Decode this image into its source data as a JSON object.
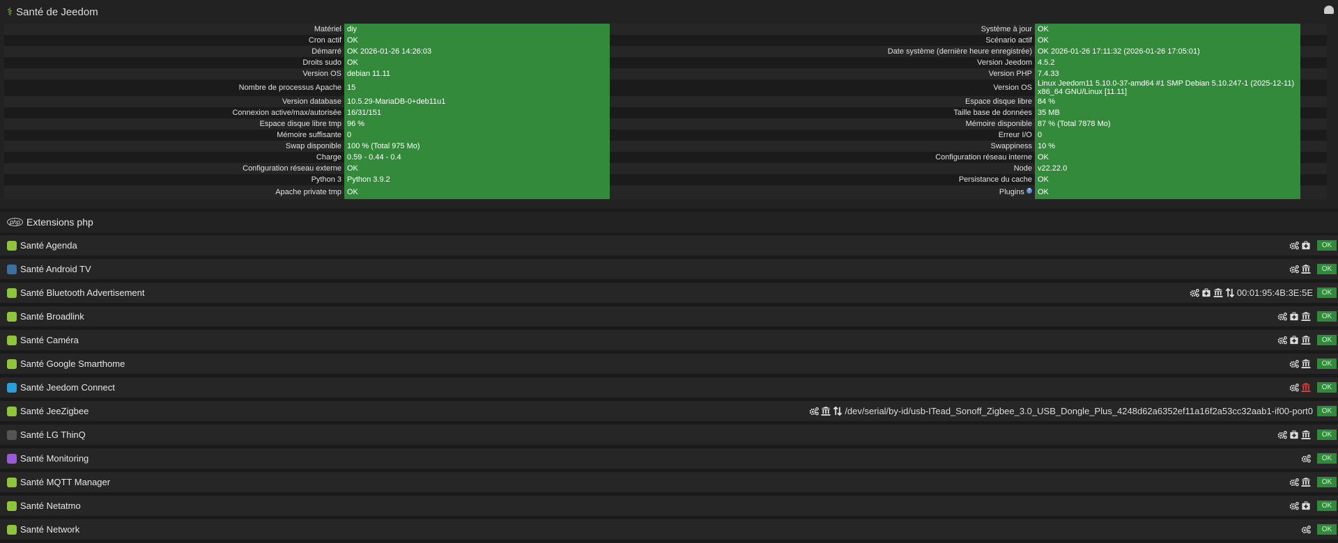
{
  "header": {
    "title": "Santé de Jeedom"
  },
  "left_table": [
    [
      "Matériel",
      "diy"
    ],
    [
      "Cron actif",
      "OK"
    ],
    [
      "Démarré",
      "OK 2026-01-26 14:26:03"
    ],
    [
      "Droits sudo",
      "OK"
    ],
    [
      "Version OS",
      "debian 11.11"
    ],
    [
      "Nombre de processus Apache",
      "15"
    ],
    [
      "Version database",
      "10.5.29-MariaDB-0+deb11u1"
    ],
    [
      "Connexion active/max/autorisée",
      "16/31/151"
    ],
    [
      "Espace disque libre tmp",
      "96 %"
    ],
    [
      "Mémoire suffisante",
      "0"
    ],
    [
      "Swap disponible",
      "100 % (Total 975 Mo)"
    ],
    [
      "Charge",
      "0.59 - 0.44 - 0.4"
    ],
    [
      "Configuration réseau externe",
      "OK"
    ],
    [
      "Python 3",
      "Python 3.9.2"
    ],
    [
      "Apache private tmp",
      "OK"
    ]
  ],
  "right_table": [
    [
      "Système à jour",
      "OK"
    ],
    [
      "Scénario actif",
      "OK"
    ],
    [
      "Date système (dernière heure enregistrée)",
      "OK 2026-01-26 17:11:32 (2026-01-26 17:05:01)"
    ],
    [
      "Version Jeedom",
      "4.5.2"
    ],
    [
      "Version PHP",
      "7.4.33"
    ],
    [
      "Version OS",
      "Linux Jeedom11 5.10.0-37-amd64 #1 SMP Debian 5.10.247-1 (2025-12-11) x86_64 GNU/Linux [11.11]"
    ],
    [
      "Espace disque libre",
      "84 %"
    ],
    [
      "Taille base de données",
      "35 MB"
    ],
    [
      "Mémoire disponible",
      "87 % (Total 7878 Mo)"
    ],
    [
      "Erreur I/O",
      "0"
    ],
    [
      "Swappiness",
      "10 %"
    ],
    [
      "Configuration réseau interne",
      "OK"
    ],
    [
      "Node",
      "v22.22.0"
    ],
    [
      "Persistance du cache",
      "OK"
    ],
    [
      "Plugins",
      "OK"
    ]
  ],
  "php_section": {
    "icon_text": "php",
    "title": "Extensions php"
  },
  "plugins": [
    {
      "name": "Santé Agenda",
      "color": "#8fc53c",
      "icons": [
        "gears",
        "medkit"
      ],
      "info": "",
      "status": "OK"
    },
    {
      "name": "Santé Android TV",
      "color": "#3b6f9e",
      "icons": [
        "gears",
        "bank"
      ],
      "info": "",
      "status": "OK"
    },
    {
      "name": "Santé Bluetooth Advertisement",
      "color": "#8fc53c",
      "icons": [
        "gears",
        "medkit",
        "bank",
        "arrows"
      ],
      "info": "00:01:95:4B:3E:5E",
      "status": "OK"
    },
    {
      "name": "Santé Broadlink",
      "color": "#8fc53c",
      "icons": [
        "gears",
        "medkit",
        "bank"
      ],
      "info": "",
      "status": "OK"
    },
    {
      "name": "Santé Caméra",
      "color": "#8fc53c",
      "icons": [
        "gears",
        "medkit",
        "bank"
      ],
      "info": "",
      "status": "OK"
    },
    {
      "name": "Santé Google Smarthome",
      "color": "#8fc53c",
      "icons": [
        "gears",
        "bank"
      ],
      "info": "",
      "status": "OK"
    },
    {
      "name": "Santé Jeedom Connect",
      "color": "#2a9fd6",
      "icons": [
        "gears",
        "bank-red"
      ],
      "info": "",
      "status": "OK"
    },
    {
      "name": "Santé JeeZigbee",
      "color": "#8fc53c",
      "icons": [
        "gears",
        "bank",
        "arrows"
      ],
      "info": "/dev/serial/by-id/usb-ITead_Sonoff_Zigbee_3.0_USB_Dongle_Plus_4248d62a6352ef11a16f2a53cc32aab1-if00-port0",
      "status": "OK"
    },
    {
      "name": "Santé LG ThinQ",
      "color": "#555555",
      "icons": [
        "gears",
        "medkit",
        "bank"
      ],
      "info": "",
      "status": "OK"
    },
    {
      "name": "Santé Monitoring",
      "color": "#9b59d6",
      "icons": [
        "gears"
      ],
      "info": "",
      "status": "OK"
    },
    {
      "name": "Santé MQTT Manager",
      "color": "#8fc53c",
      "icons": [
        "gears",
        "bank"
      ],
      "info": "",
      "status": "OK"
    },
    {
      "name": "Santé Netatmo",
      "color": "#8fc53c",
      "icons": [
        "gears",
        "medkit"
      ],
      "info": "",
      "status": "OK"
    },
    {
      "name": "Santé Network",
      "color": "#8fc53c",
      "icons": [
        "gears"
      ],
      "info": "",
      "status": "OK"
    }
  ]
}
